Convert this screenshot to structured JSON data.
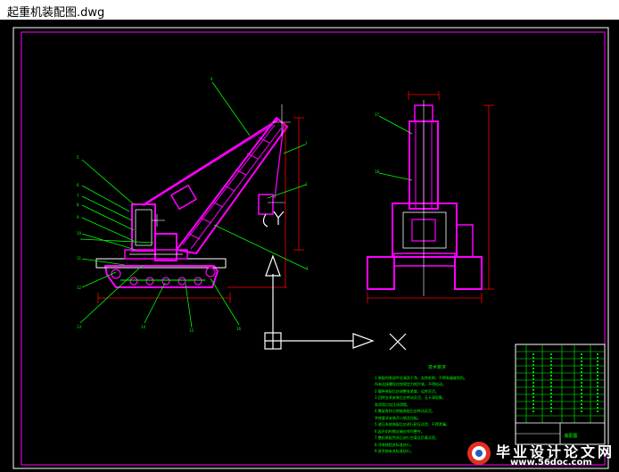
{
  "window": {
    "title": "起重机装配图.dwg"
  },
  "drawing": {
    "notes_title": "技术要求",
    "notes_lines": [
      "1.装配时各部件应清洗干净，去除毛刺，不得有磕碰划伤。",
      "  所有连接螺栓应按规定力矩拧紧，不得松动。",
      "2.履带装配后应调整张紧度，运转灵活。",
      "3.回转支承安装后应转动灵活，无卡滞现象。",
      "  各润滑点加注润滑脂。",
      "4.臂架各铰点销轴装配后应转动灵活，",
      "  并按要求安装开口销及挡板。",
      "5.液压系统装配后应进行耐压试验，不得渗漏。",
      "6.起升机构钢丝绳应排列整齐。",
      "7.整机装配完成后进行空载及负载试验。",
      "8.涂装按相关标准执行。",
      "9.其余按有关标准执行。"
    ],
    "title_block": {
      "name": "装配图"
    }
  },
  "watermark": {
    "title": "毕业设计论文网",
    "url": "www.56doc.com"
  },
  "colors": {
    "magenta": "#ff00ff",
    "green": "#00ff00",
    "white": "#ffffff",
    "red": "#ff0000",
    "background": "#000000"
  }
}
